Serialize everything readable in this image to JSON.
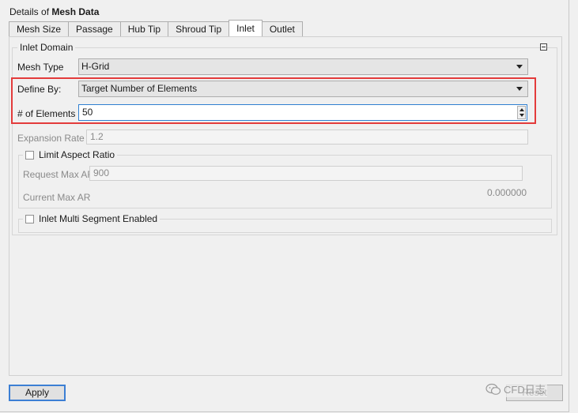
{
  "header": {
    "title_prefix": "Details of",
    "title_bold": "Mesh Data"
  },
  "tabs": [
    {
      "label": "Mesh Size",
      "active": false
    },
    {
      "label": "Passage",
      "active": false
    },
    {
      "label": "Hub Tip",
      "active": false
    },
    {
      "label": "Shroud Tip",
      "active": false
    },
    {
      "label": "Inlet",
      "active": true
    },
    {
      "label": "Outlet",
      "active": false
    }
  ],
  "inlet_domain": {
    "title": "Inlet Domain",
    "mesh_type": {
      "label": "Mesh Type",
      "value": "H-Grid"
    },
    "define_by": {
      "label": "Define By:",
      "value": "Target Number of Elements"
    },
    "num_elements": {
      "label": "# of Elements",
      "value": "50"
    },
    "expansion_rate": {
      "label": "Expansion Rate",
      "value": "1.2"
    },
    "limit_aspect_ratio": {
      "label": "Limit Aspect Ratio",
      "checked": false,
      "request_max_ar_label": "Request Max AR",
      "request_max_ar_value": "900",
      "current_max_ar_label": "Current Max AR",
      "current_max_ar_value": "0.000000"
    },
    "multi_segment": {
      "label": "Inlet Multi Segment Enabled",
      "checked": false
    }
  },
  "footer": {
    "apply_label": "Apply",
    "reset_label": "Reset"
  },
  "watermark": {
    "text": "CFD日志"
  },
  "colors": {
    "highlight": "#e33b3b",
    "focus": "#2f7fd0"
  },
  "icons": {
    "collapse": "minus-box-icon",
    "combo_arrow": "triangle-down-icon",
    "spinner": "up-down-arrows-icon",
    "watermark": "wechat-logo-icon"
  }
}
